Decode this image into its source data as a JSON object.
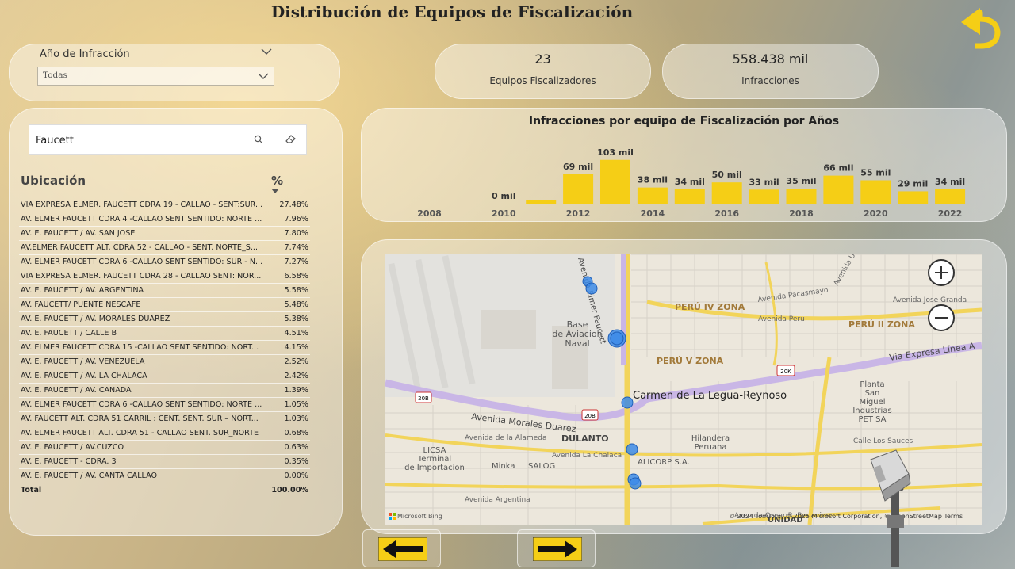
{
  "page": {
    "title": "Distribución de Equipos de Fiscalización"
  },
  "slicer": {
    "label": "Año de Infracción",
    "value": "Todas"
  },
  "kpis": {
    "equipos": {
      "value": "23",
      "caption": "Equipos Fiscalizadores"
    },
    "infracciones": {
      "value": "558.438 mil",
      "caption": "Infracciones"
    }
  },
  "search": {
    "value": "Faucett"
  },
  "table": {
    "headers": {
      "location": "Ubicación",
      "percent": "%"
    },
    "rows": [
      {
        "location": "VIA EXPRESA ELMER. FAUCETT CDRA 19 - CALLAO - SENT:SUR...",
        "percent": "27.48%"
      },
      {
        "location": "AV. ELMER FAUCETT CDRA 4 -CALLAO SENT SENTIDO: NORTE ...",
        "percent": "7.96%"
      },
      {
        "location": "AV. E. FAUCETT / AV. SAN JOSE",
        "percent": "7.80%"
      },
      {
        "location": "AV.ELMER FAUCETT ALT. CDRA 52 - CALLAO - SENT. NORTE_S...",
        "percent": "7.74%"
      },
      {
        "location": "AV. ELMER FAUCETT CDRA 6 -CALLAO SENT SENTIDO: SUR - N...",
        "percent": "7.27%"
      },
      {
        "location": "VIA EXPRESA ELMER. FAUCETT CDRA 28 - CALLAO SENT: NOR...",
        "percent": "6.58%"
      },
      {
        "location": "AV. E. FAUCETT / AV. ARGENTINA",
        "percent": "5.58%"
      },
      {
        "location": "AV. FAUCETT/ PUENTE NESCAFE",
        "percent": "5.48%"
      },
      {
        "location": "AV. E. FAUCETT / AV. MORALES DUAREZ",
        "percent": "5.38%"
      },
      {
        "location": "AV. E. FAUCETT / CALLE B",
        "percent": "4.51%"
      },
      {
        "location": "AV. ELMER FAUCETT CDRA 15 -CALLAO SENT SENTIDO: NORT...",
        "percent": "4.15%"
      },
      {
        "location": "AV. E. FAUCETT / AV. VENEZUELA",
        "percent": "2.52%"
      },
      {
        "location": "AV. E. FAUCETT / AV. LA CHALACA",
        "percent": "2.42%"
      },
      {
        "location": "AV. E. FAUCETT / AV. CANADA",
        "percent": "1.39%"
      },
      {
        "location": "AV. ELMER FAUCETT CDRA 6 -CALLAO SENT SENTIDO: NORTE ...",
        "percent": "1.05%"
      },
      {
        "location": "AV. FAUCETT ALT. CDRA 51 CARRIL : CENT. SENT. SUR – NORT...",
        "percent": "1.03%"
      },
      {
        "location": "AV. ELMER FAUCETT ALT. CDRA 51 - CALLAO SENT. SUR_NORTE",
        "percent": "0.68%"
      },
      {
        "location": "AV. E. FAUCETT / AV.CUZCO",
        "percent": "0.63%"
      },
      {
        "location": "AV. E. FAUCETT - CDRA. 3",
        "percent": "0.35%"
      },
      {
        "location": "AV. E. FAUCETT / AV. CANTA CALLAO",
        "percent": "0.00%"
      }
    ],
    "total": {
      "label": "Total",
      "percent": "100.00%"
    }
  },
  "chart_data": {
    "type": "bar",
    "title": "Infracciones por equipo de Fiscalización por Años",
    "categories": [
      "2008",
      "2009",
      "2010",
      "2011",
      "2012",
      "2013",
      "2014",
      "2015",
      "2016",
      "2017",
      "2018",
      "2019",
      "2020",
      "2021",
      "2022"
    ],
    "values": [
      null,
      null,
      0,
      8,
      69,
      103,
      38,
      34,
      50,
      33,
      35,
      66,
      55,
      29,
      34
    ],
    "data_labels": [
      "",
      "",
      "0 mil",
      "",
      "69 mil",
      "103 mil",
      "38 mil",
      "34 mil",
      "50 mil",
      "33 mil",
      "35 mil",
      "66 mil",
      "55 mil",
      "29 mil",
      "34 mil"
    ],
    "tick_labels": [
      "2008",
      "",
      "2010",
      "",
      "2012",
      "",
      "2014",
      "",
      "2016",
      "",
      "2018",
      "",
      "2020",
      "",
      "2022"
    ],
    "unit": "mil",
    "ylim": [
      0,
      110
    ],
    "color": "#F5CE16",
    "grid": false,
    "xlabel": "",
    "ylabel": ""
  },
  "map": {
    "labels": {
      "base": "Base\nde Aviacion\nNaval",
      "peru4": "PERÚ IV ZONA",
      "peru5": "PERÚ V ZONA",
      "peru2": "PERÚ II ZONA",
      "carmen": "Carmen de La Legua-Reynoso",
      "dulanto": "DULANTO",
      "licsa": "LICSA\nTerminal\nde Importacion",
      "minka": "Minka",
      "salog": "SALOG",
      "alicorp": "ALICORP S.A.",
      "hilandera": "Hilandera\nPeruana",
      "planta": "Planta\nSan\nMiguel\nIndustrias\nPET SA",
      "unidad": "UNIDAD",
      "via_expresa": "Via Expresa Línea A",
      "av_morales": "Avenida Morales Duarez",
      "av_chalaca": "Avenida La Chalaca",
      "av_argentina": "Avenida Argentina",
      "av_alameda": "Avenida de la Alameda",
      "av_pacasmayo": "Avenida Pacasmayo",
      "av_peru": "Avenida Peru",
      "av_jose_granda": "Avenida Jose Granda",
      "av_universitaria": "Avenida Universitaria",
      "av_elmer": "Avenida Elmer Faucett",
      "av_benavides": "Avenida Oscar R. Benavides",
      "calle_sauces": "Calle Los Sauces",
      "shield_20b_a": "20B",
      "shield_20b_b": "20B",
      "shield_20k": "20K",
      "jes": "ES"
    },
    "logo": "Microsoft Bing",
    "attribution": "© 2024 TomTom, © 2025 Microsoft Corporation, © OpenStreetMap  Terms"
  },
  "colors": {
    "accent": "#F5CE16",
    "marker": "#3D8BE8"
  }
}
